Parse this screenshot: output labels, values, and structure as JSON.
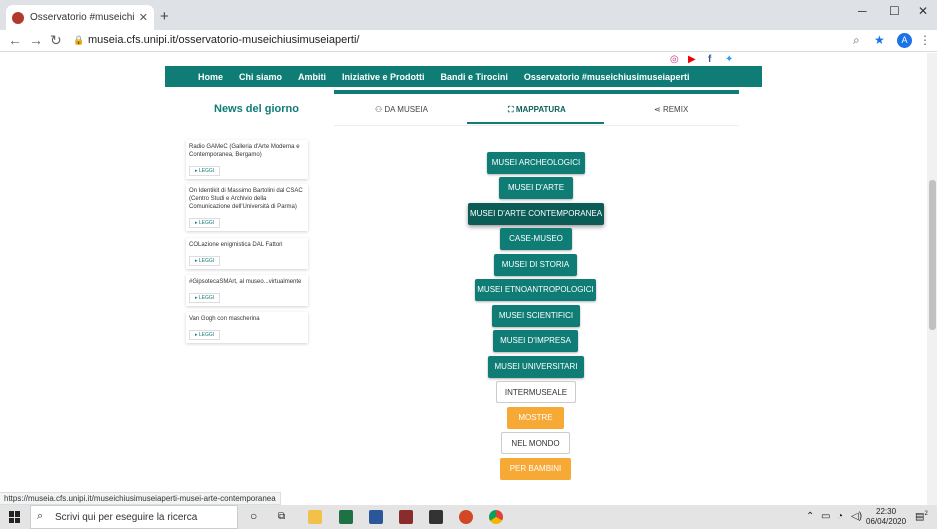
{
  "browser": {
    "tab_title": "Osservatorio #museichiusimuse",
    "url": "museia.cfs.unipi.it/osservatorio-museichiusimuseiaperti/",
    "profile_initial": "A",
    "status_url": "https://museia.cfs.unipi.it/museichiusimuseiaperti-musei-arte-contemporanea"
  },
  "nav": [
    "Home",
    "Chi siamo",
    "Ambiti",
    "Iniziative e Prodotti",
    "Bandi e Tirocini",
    "Osservatorio #museichiusimuseiaperti"
  ],
  "news": {
    "title": "News del giorno",
    "read_label": "LEGGI",
    "items": [
      "Radio GAMeC (Galleria d'Arte Moderna e Contemporanea, Bergamo)",
      "On Identikit di Massimo Bartolini dal CSAC (Centro Studi e Archivio della Comunicazione dell'Università di Parma)",
      "COLazione enigmistica DAL Fattori",
      "#GipsotecaSMArt, al museo...virtualmente",
      "Van Gogh con mascherina"
    ]
  },
  "subtabs": [
    "DA MUSEIA",
    "MAPPATURA",
    "REMIX"
  ],
  "categories": [
    "MUSEI ARCHEOLOGICI",
    "MUSEI D'ARTE",
    "MUSEI D'ARTE CONTEMPORANEA",
    "CASE-MUSEO",
    "MUSEI DI STORIA",
    "MUSEI ETNOANTROPOLOGICI",
    "MUSEI SCIENTIFICI",
    "MUSEI D'IMPRESA",
    "MUSEI UNIVERSITARI",
    "INTERMUSEALE",
    "MOSTRE",
    "NEL MONDO",
    "PER BAMBINI"
  ],
  "taskbar": {
    "search_placeholder": "Scrivi qui per eseguire la ricerca",
    "time": "22:30",
    "date": "06/04/2020",
    "notifications": "2"
  }
}
